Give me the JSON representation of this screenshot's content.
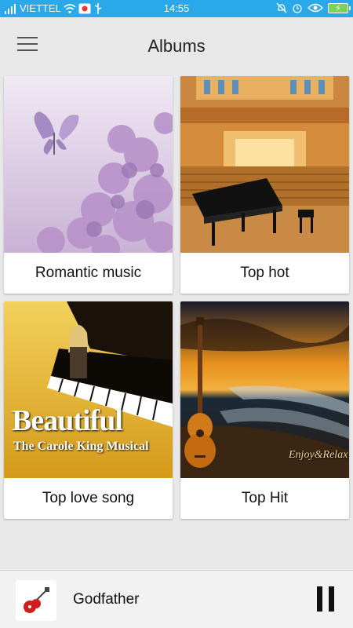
{
  "status_bar": {
    "carrier": "VIETTEL",
    "time": "14:55",
    "background_color": "#29a9ea"
  },
  "app_bar": {
    "title": "Albums",
    "menu_icon": "hamburger-menu-icon"
  },
  "albums": [
    {
      "label": "Romantic music",
      "art": "butterfly-blossoms"
    },
    {
      "label": "Top hot",
      "art": "concert-hall-piano"
    },
    {
      "label": "Top love song",
      "art": "beautiful-carole-king-musical",
      "art_text": [
        "Beautiful",
        "The Carole King Musical"
      ]
    },
    {
      "label": "Top Hit",
      "art": "guitar-on-beach-sunset",
      "art_text": [
        "Enjoy&Relax"
      ]
    }
  ],
  "player": {
    "track_title": "Godfather",
    "state_icon": "pause-icon",
    "cover_icon": "guitar-cover-icon"
  }
}
